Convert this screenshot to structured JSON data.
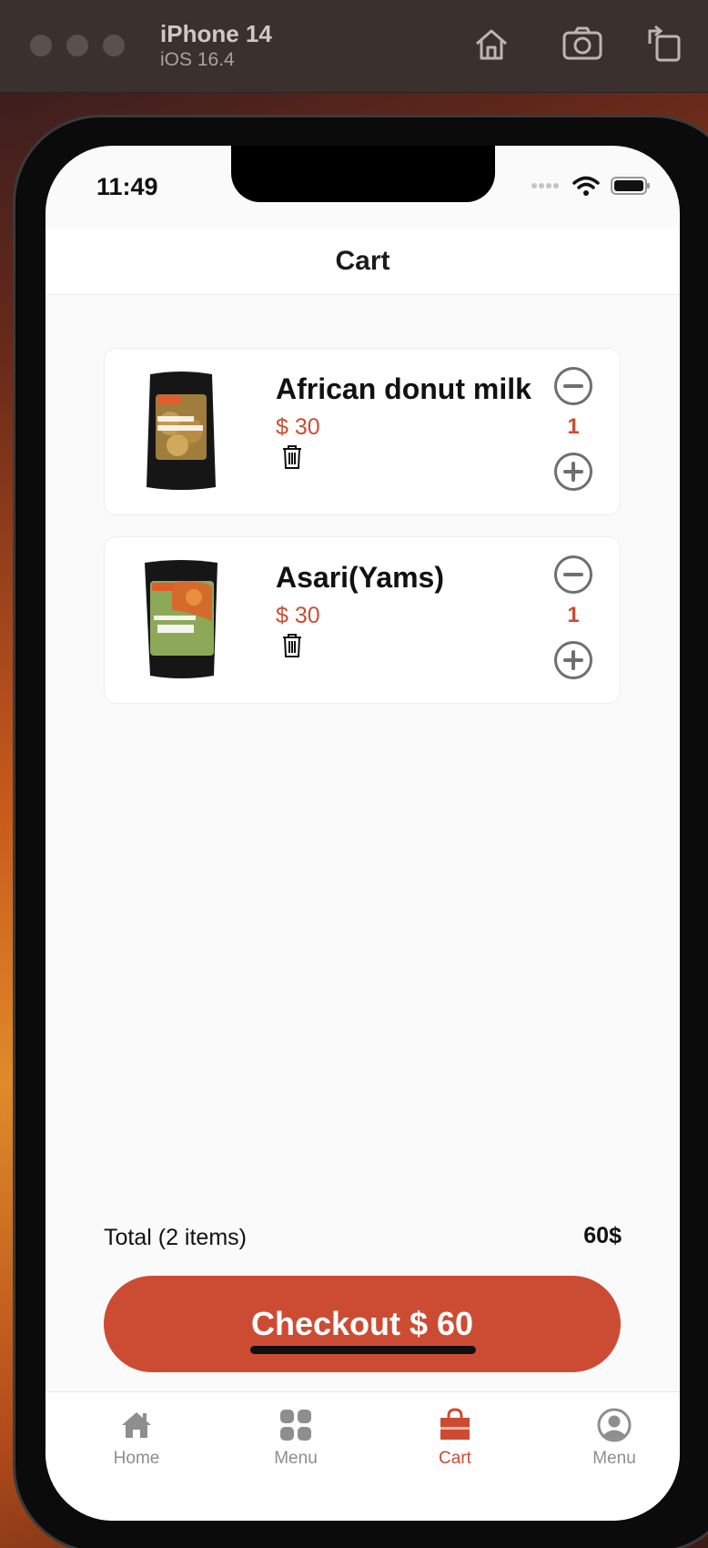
{
  "simulator": {
    "device_name": "iPhone 14",
    "os_version": "iOS 16.4",
    "icons": [
      "home-icon",
      "screenshot-icon",
      "rotate-icon"
    ]
  },
  "status_bar": {
    "time": "11:49"
  },
  "header": {
    "title": "Cart"
  },
  "cart": {
    "items": [
      {
        "name": "African donut milk",
        "price": "$ 30",
        "quantity": "1"
      },
      {
        "name": "Asari(Yams)",
        "price": "$ 30",
        "quantity": "1"
      }
    ],
    "total_label": "Total (2 items)",
    "total_value": "60$",
    "checkout_label": "Checkout $ 60"
  },
  "tabbar": {
    "tabs": [
      {
        "label": "Home",
        "icon": "home-icon",
        "active": false
      },
      {
        "label": "Menu",
        "icon": "grid-icon",
        "active": false
      },
      {
        "label": "Cart",
        "icon": "shopping-bag-icon",
        "active": true
      },
      {
        "label": "Menu",
        "icon": "profile-icon",
        "active": false
      }
    ]
  },
  "colors": {
    "accent": "#cc4c33",
    "inactive": "#8e8e8e",
    "background": "#fafafa"
  }
}
